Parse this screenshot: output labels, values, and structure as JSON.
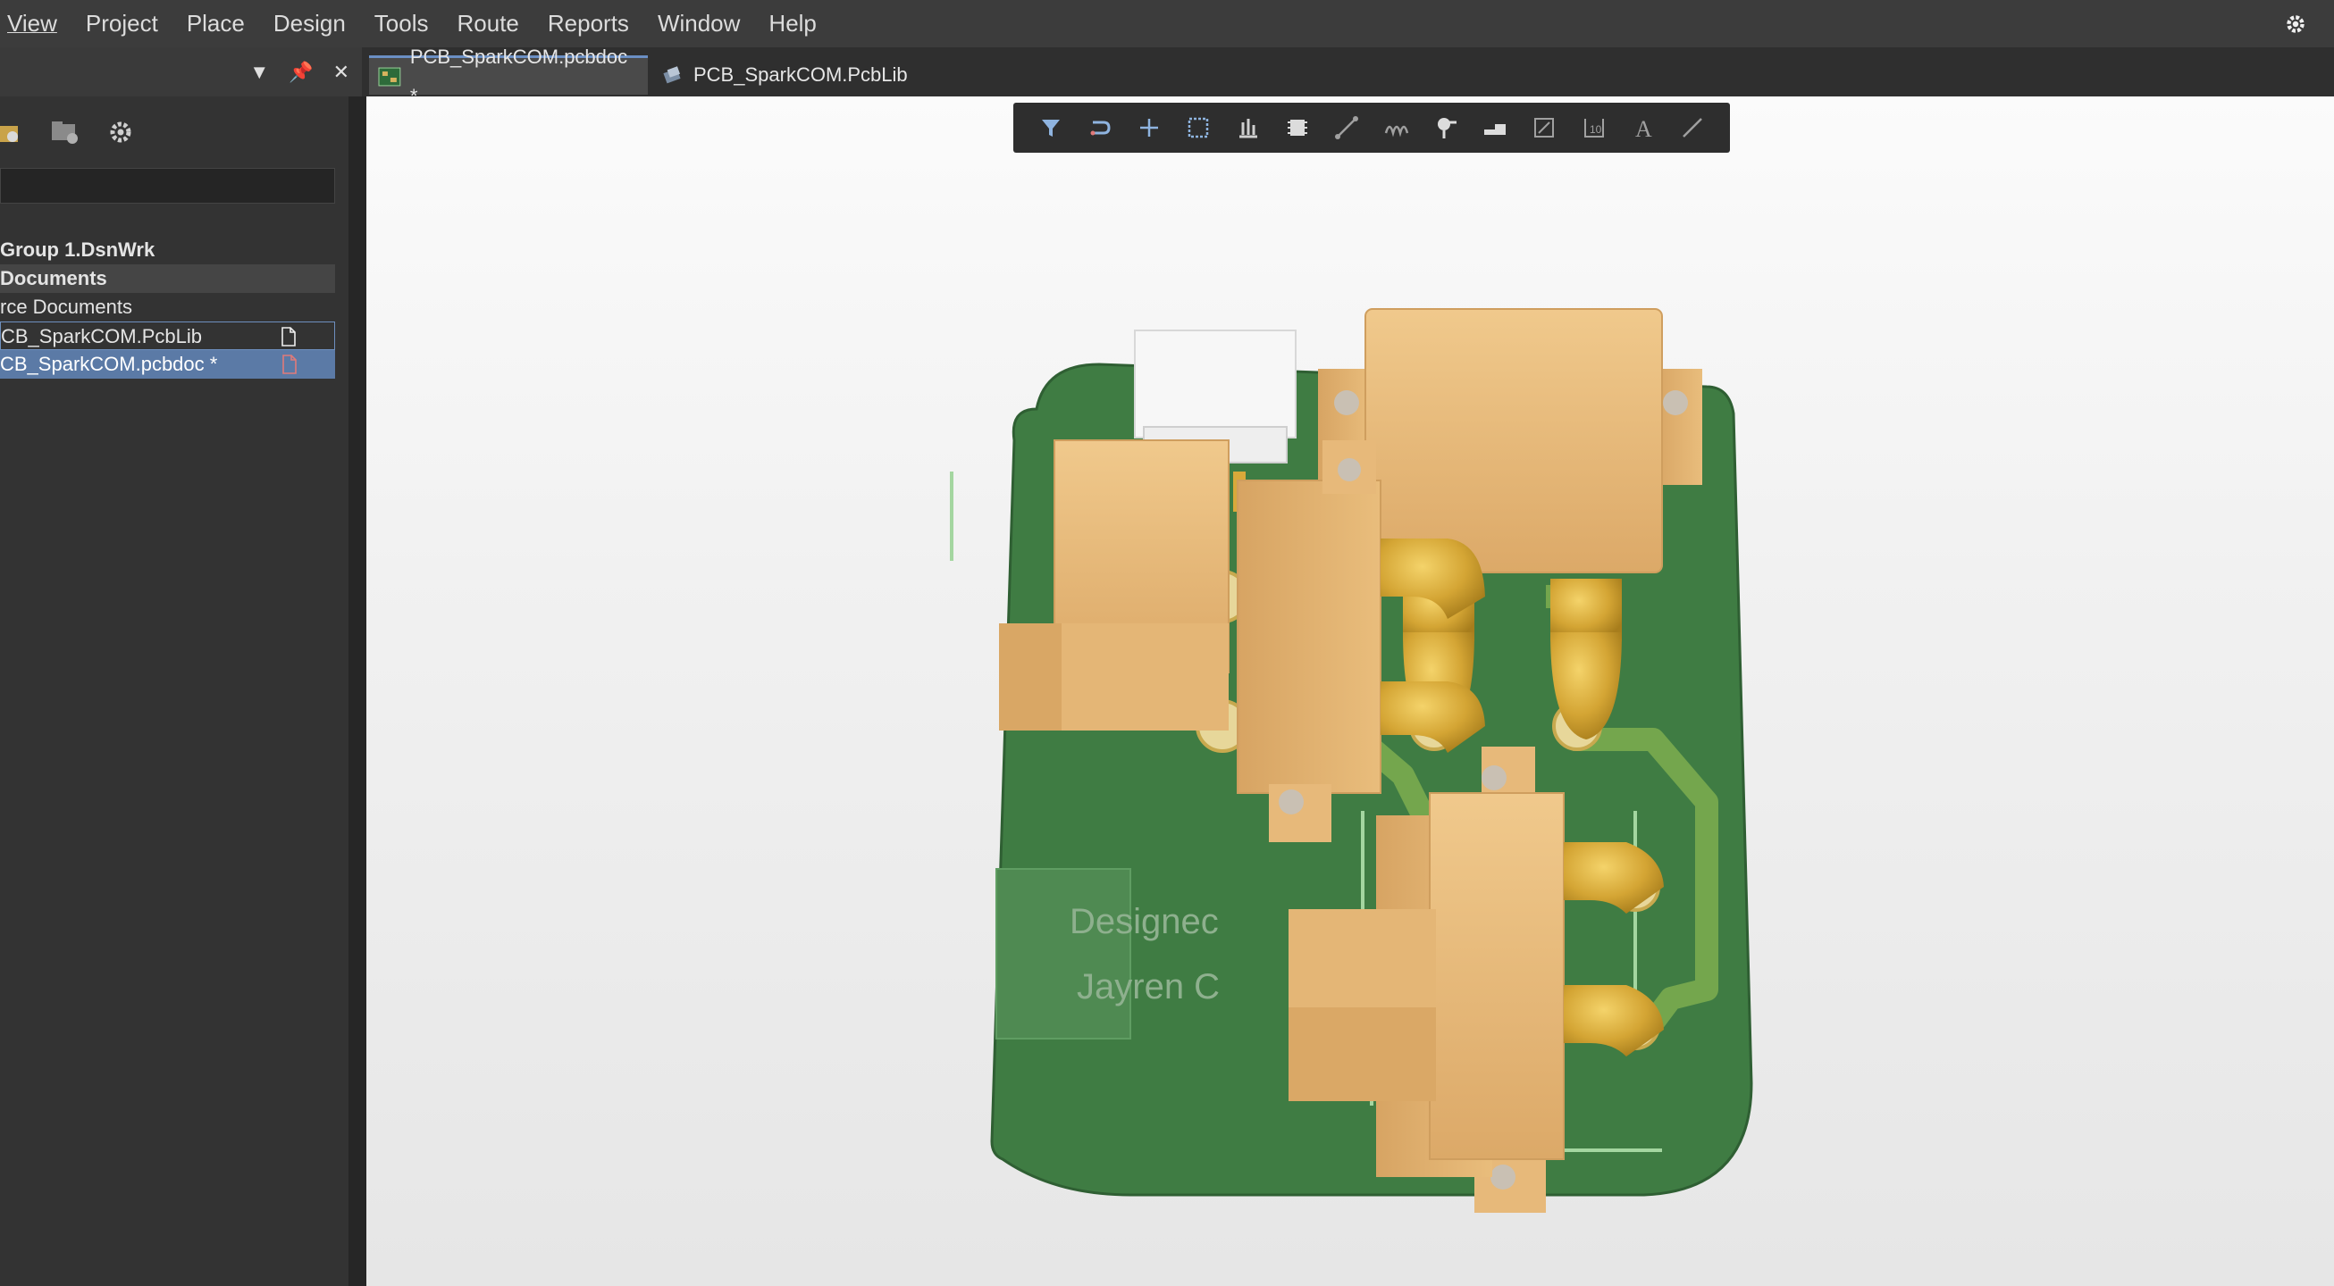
{
  "menubar": {
    "items": [
      "View",
      "Project",
      "Place",
      "Design",
      "Tools",
      "Route",
      "Reports",
      "Window",
      "Help"
    ],
    "accelerators": [
      "V",
      "j",
      "P",
      "D",
      "T",
      "u",
      "R",
      "W",
      "H"
    ]
  },
  "tabs": [
    {
      "label": "PCB_SparkCOM.pcbdoc *",
      "active": true,
      "icon": "pcb-document-icon"
    },
    {
      "label": "PCB_SparkCOM.PcbLib",
      "active": false,
      "icon": "pcb-library-icon"
    }
  ],
  "projects_panel": {
    "tree": {
      "workspace": "Group 1.DsnWrk",
      "section": "Documents",
      "subsection": "rce Documents",
      "files": [
        {
          "label": "CB_SparkCOM.PcbLib",
          "state": "outlined"
        },
        {
          "label": "CB_SparkCOM.pcbdoc *",
          "state": "selected"
        }
      ]
    }
  },
  "board": {
    "silkscreen_line1": "Designec",
    "silkscreen_line2": "Jayren C"
  },
  "toolbar_icons": [
    "filter-icon",
    "snap-icon",
    "cross-icon",
    "select-rect-icon",
    "align-icon",
    "component-icon",
    "route-icon",
    "diff-pair-icon",
    "pad-icon",
    "polygon-icon",
    "dimension-icon",
    "board-icon",
    "text-icon",
    "line-icon"
  ],
  "colors": {
    "board": "#3f7c43",
    "trace": "#7aab4f",
    "connector": "#e8bc7c",
    "gold": "#d9a93a",
    "selection": "#5b7aa6"
  }
}
